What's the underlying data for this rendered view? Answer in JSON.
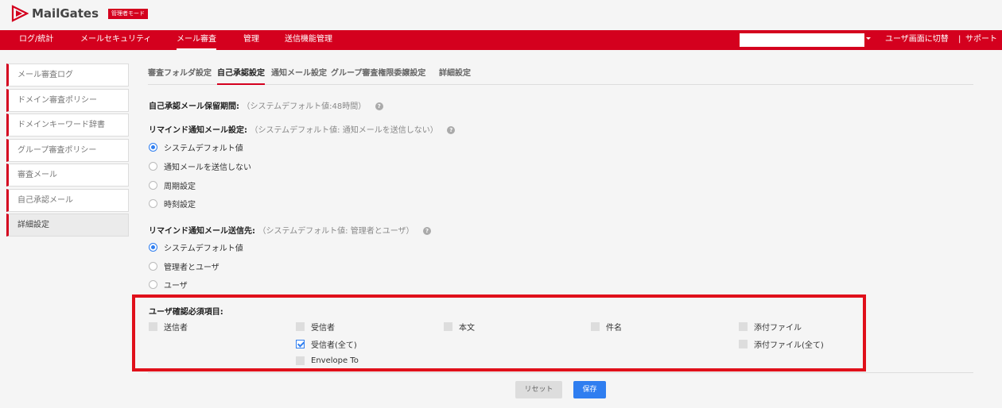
{
  "app": {
    "name": "MailGates",
    "badge": "管理者モード"
  },
  "nav": {
    "items": [
      "ログ/統計",
      "メールセキュリティ",
      "メール審査",
      "管理",
      "送信機能管理"
    ],
    "active_index": 2,
    "switch_label": "ユーザ画面に切替",
    "separator": "|",
    "support_label": "サポート"
  },
  "sidebar": {
    "items": [
      "メール審査ログ",
      "ドメイン審査ポリシー",
      "ドメインキーワード辞書",
      "グループ審査ポリシー",
      "審査メール",
      "自己承認メール",
      "詳細設定"
    ],
    "active_index": 6
  },
  "tabs": {
    "items": [
      "審査フォルダ設定",
      "自己承認設定",
      "通知メール設定",
      "グループ審査権限委譲設定",
      "詳細設定"
    ],
    "active_index": 1
  },
  "form": {
    "retention": {
      "label": "自己承認メール保留期間:",
      "hint": "（システムデフォルト値:48時間）"
    },
    "remind": {
      "label": "リマインド通知メール設定:",
      "hint": "（システムデフォルト値: 通知メールを送信しない）",
      "options": [
        "システムデフォルト値",
        "通知メールを送信しない",
        "周期設定",
        "時刻設定"
      ],
      "selected_index": 0
    },
    "recipient": {
      "label": "リマインド通知メール送信先:",
      "hint": "（システムデフォルト値: 管理者とユーザ）",
      "options": [
        "システムデフォルト値",
        "管理者とユーザ",
        "ユーザ"
      ],
      "selected_index": 0
    },
    "required": {
      "label": "ユーザ確認必須項目:",
      "items": [
        {
          "label": "送信者",
          "checked": false
        },
        {
          "label": "受信者",
          "checked": false
        },
        {
          "label": "本文",
          "checked": false
        },
        {
          "label": "件名",
          "checked": false
        },
        {
          "label": "添付ファイル",
          "checked": false
        },
        {
          "label": "受信者(全て)",
          "checked": true
        },
        {
          "label": "添付ファイル(全て)",
          "checked": false
        },
        {
          "label": "Envelope To",
          "checked": false
        }
      ]
    }
  },
  "buttons": {
    "reset": "リセット",
    "save": "保存"
  },
  "icons": {
    "help": "?"
  },
  "colors": {
    "brand_red": "#d4001e",
    "accent_blue": "#2f7ef0",
    "highlight_red": "#e0101a"
  }
}
